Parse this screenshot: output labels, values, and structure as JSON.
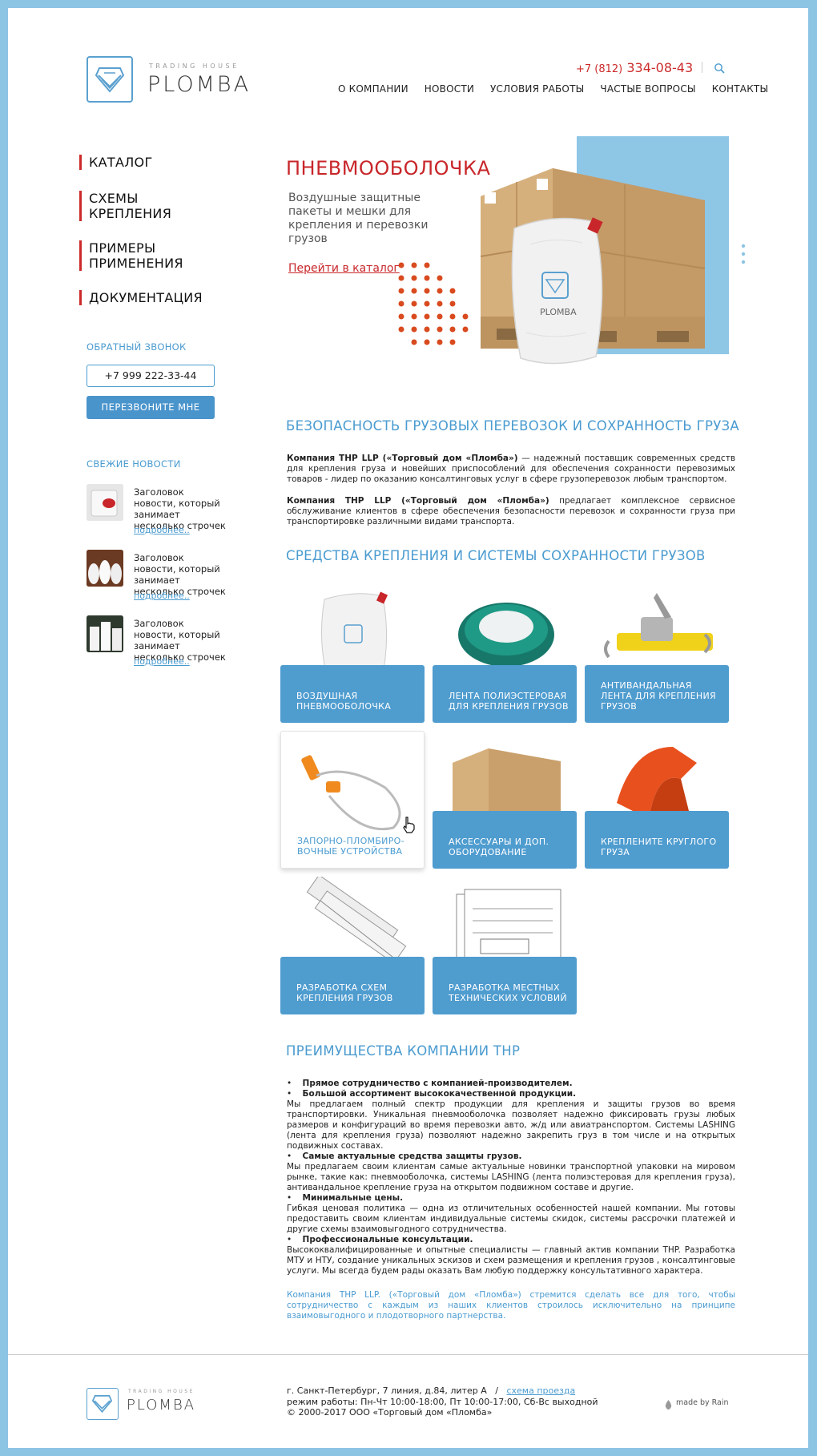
{
  "header": {
    "logo_small": "TRADING HOUSE",
    "logo_big": "PLOMBA",
    "phone_prefix": "+7 (812)",
    "phone_main": "334-08-43",
    "nav": [
      "О КОМПАНИИ",
      "НОВОСТИ",
      "УСЛОВИЯ РАБОТЫ",
      "ЧАСТЫЕ ВОПРОСЫ",
      "КОНТАКТЫ"
    ]
  },
  "sidebar": {
    "menu": [
      "КАТАЛОГ",
      "СХЕМЫ КРЕПЛЕНИЯ",
      "ПРИМЕРЫ ПРИМЕНЕНИЯ",
      "ДОКУМЕНТАЦИЯ"
    ],
    "callback_title": "ОБРАТНЫЙ ЗВОНОК",
    "callback_phone": "+7 999 222-33-44",
    "callback_button": "ПЕРЕЗВОНИТЕ МНЕ",
    "news_title": "СВЕЖИЕ НОВОСТИ",
    "news": [
      {
        "title": "Заголовок новости, который занимает несколько строчек",
        "more": "подробнее.."
      },
      {
        "title": "Заголовок новости, который занимает несколько строчек",
        "more": "подробнее.."
      },
      {
        "title": "Заголовок новости, который занимает несколько строчек",
        "more": "подробнее.."
      }
    ]
  },
  "hero": {
    "title": "ПНЕВМООБОЛОЧКА",
    "subtitle": "Воздушные защитные пакеты и мешки для крепления и перевозки грузов",
    "link": "Перейти в каталог",
    "bag_brand": "PLOMBA"
  },
  "safety": {
    "title": "БЕЗОПАСНОСТЬ ГРУЗОВЫХ ПЕРЕВОЗОК И СОХРАННОСТЬ ГРУЗА",
    "p1_bold": "Компания THP LLP («Торговый дом «Пломба»)",
    "p1_text": "— надежный поставщик современных средств для крепления груза и новейших приспособлений для обеспечения сохранности перевозимых товаров - лидер по оказанию консалтинговых услуг в сфере грузоперевозок любым транспортом.",
    "p2_bold": "Компания THP LLP («Торговый дом «Пломба»)",
    "p2_text": "предлагает комплексное сервисное обслуживание клиентов в сфере обеспечения безопасности перевозок и сохранности груза при транспортировке различными видами транспорта."
  },
  "products": {
    "title": "СРЕДСТВА КРЕПЛЕНИЯ И СИСТЕМЫ СОХРАННОСТИ ГРУЗОВ",
    "items": [
      {
        "label": "ВОЗДУШНАЯ ПНЕВМООБОЛОЧКА"
      },
      {
        "label": "ЛЕНТА ПОЛИЭСТЕРОВАЯ ДЛЯ КРЕПЛЕНИЯ ГРУЗОВ"
      },
      {
        "label": "АНТИВАНДАЛЬНАЯ ЛЕНТА ДЛЯ КРЕПЛЕНИЯ ГРУЗОВ"
      },
      {
        "label": "ЗАПОРНО-ПЛОМБИРО-ВОЧНЫЕ УСТРОЙСТВА"
      },
      {
        "label": "АКСЕССУАРЫ И ДОП. ОБОРУДОВАНИЕ"
      },
      {
        "label": "КРЕПЛЕНИТЕ КРУГЛОГО ГРУЗА"
      },
      {
        "label": "РАЗРАБОТКА СХЕМ КРЕПЛЕНИЯ ГРУЗОВ"
      },
      {
        "label": "РАЗРАБОТКА МЕСТНЫХ ТЕХНИЧЕСКИХ УСЛОВИЙ"
      }
    ]
  },
  "advantages": {
    "title": "ПРЕИМУЩЕСТВА КОМПАНИИ THP",
    "b1": "Прямое сотрудничество с компанией-производителем.",
    "b2": "Большой ассортимент высококачественной продукции.",
    "t2": "Мы предлагаем полный спектр продукции для крепления и защиты грузов во время транспортировки. Уникальная пневмооболочка позволяет надежно фиксировать грузы любых размеров и конфигураций во время перевозки авто, ж/д или авиатранспортом. Системы LASHING (лента для крепления груза) позволяют надежно закрепить груз в том числе и на открытых подвижных составах.",
    "b3": "Самые актуальные средства защиты грузов.",
    "t3": "Мы предлагаем своим клиентам самые актуальные новинки транспортной упаковки на мировом рынке, такие как: пневмооболочка, системы LASHING (лента полиэстеровая для крепления груза), антивандальное крепление груза на открытом подвижном составе и другие.",
    "b4": "Минимальные цены.",
    "t4": "Гибкая ценовая политика — одна из отличительных особенностей нашей компании. Мы готовы предоставить своим клиентам индивидуальные системы скидок, системы рассрочки платежей и другие схемы взаимовыгодного сотрудничества.",
    "b5": "Профессиональные консультации.",
    "t5": "Высококвалифицированные и опытные специалисты — главный актив компании THP. Разработка МТУ и НТУ, создание уникальных эскизов и схем размещения и крепления грузов , консалтинговые услуги. Мы всегда будем рады оказать Вам любую поддержку консультативного характера.",
    "outro": "Компания THP LLP. («Торговый дом «Пломба») стремится сделать все для того, чтобы сотрудничество с каждым из наших клиентов строилось исключительно на принципе взаимовыгодного и плодотворного партнерства."
  },
  "footer": {
    "address": "г. Санкт-Петербург, 7 линия, д.84, литер А",
    "separator": "/",
    "map_link": "схема проезда",
    "hours": "режим работы: Пн-Чт 10:00-18:00, Пт 10:00-17:00, Сб-Вс выходной",
    "copyright": "© 2000-2017 ООО «Торговый дом «Пломба»",
    "madeby": "made by Rain"
  },
  "colors": {
    "accent": "#4a9bd0",
    "red": "#c8262a",
    "frame": "#8cc4e4"
  }
}
